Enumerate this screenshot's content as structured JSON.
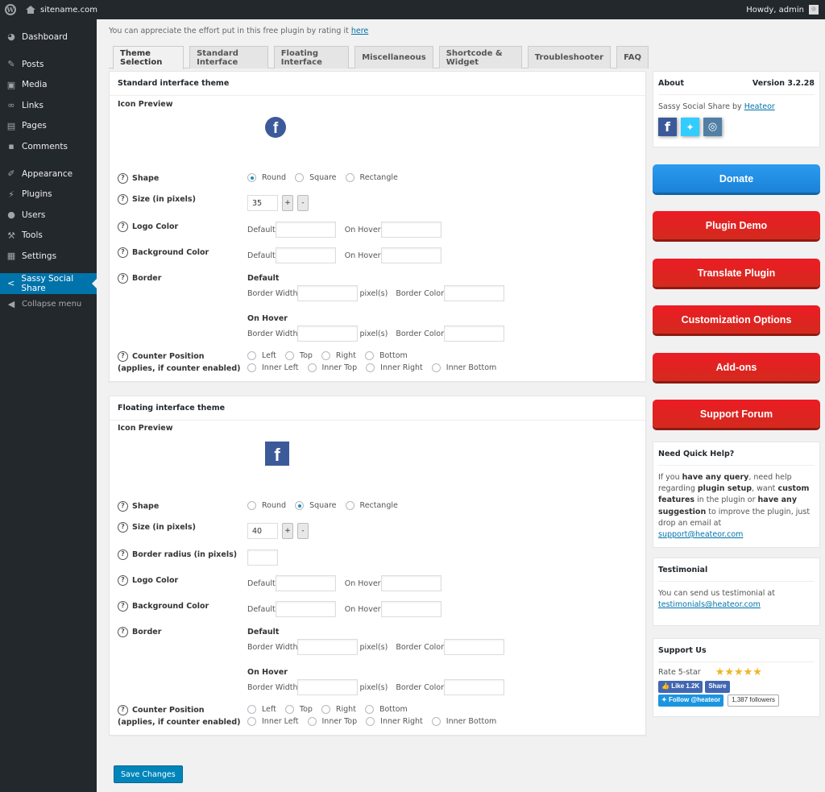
{
  "adminbar": {
    "site_name": "sitename.com",
    "howdy": "Howdy, admin"
  },
  "sidebar": {
    "items": [
      {
        "label": "Dashboard",
        "icon": "dashboard-icon"
      },
      {
        "label": "Posts",
        "icon": "pin-icon"
      },
      {
        "label": "Media",
        "icon": "media-icon"
      },
      {
        "label": "Links",
        "icon": "link-icon"
      },
      {
        "label": "Pages",
        "icon": "pages-icon"
      },
      {
        "label": "Comments",
        "icon": "comment-icon"
      },
      {
        "label": "Appearance",
        "icon": "brush-icon"
      },
      {
        "label": "Plugins",
        "icon": "plugin-icon"
      },
      {
        "label": "Users",
        "icon": "user-icon"
      },
      {
        "label": "Tools",
        "icon": "wrench-icon"
      },
      {
        "label": "Settings",
        "icon": "settings-icon"
      },
      {
        "label": "Sassy Social Share",
        "icon": "share-icon",
        "active": true
      },
      {
        "label": "Collapse menu",
        "icon": "collapse-icon"
      }
    ]
  },
  "notice": {
    "text": "You can appreciate the effort put in this free plugin by rating it ",
    "link": "here"
  },
  "tabs": [
    "Theme Selection",
    "Standard Interface",
    "Floating Interface",
    "Miscellaneous",
    "Shortcode & Widget",
    "Troubleshooter",
    "FAQ"
  ],
  "labels": {
    "icon_preview": "Icon Preview",
    "shape": "Shape",
    "size": "Size (in pixels)",
    "border_radius": "Border radius (in pixels)",
    "logo_color": "Logo Color",
    "background_color": "Background Color",
    "border": "Border",
    "counter_position": "Counter Position",
    "counter_note": "(applies, if counter enabled)",
    "default": "Default",
    "on_hover": "On Hover",
    "border_width": "Border Width",
    "pixels": "pixel(s)",
    "border_color": "Border Color",
    "plus": "+",
    "minus": "-",
    "fb_glyph": "f"
  },
  "shape_options": [
    "Round",
    "Square",
    "Rectangle"
  ],
  "counter_options_row1": [
    "Left",
    "Top",
    "Right",
    "Bottom"
  ],
  "counter_options_row2": [
    "Inner Left",
    "Inner Top",
    "Inner Right",
    "Inner Bottom"
  ],
  "standard": {
    "title": "Standard interface theme",
    "shape_selected": "Round",
    "size": "35",
    "logo_default": "",
    "logo_hover": "",
    "bg_default": "",
    "bg_hover": "",
    "border_width": "",
    "border_color": "",
    "hover_border_width": "",
    "hover_border_color": ""
  },
  "floating": {
    "title": "Floating interface theme",
    "shape_selected": "Square",
    "size": "40",
    "border_radius": "",
    "logo_default": "",
    "logo_hover": "",
    "bg_default": "",
    "bg_hover": "",
    "border_width": "",
    "border_color": "",
    "hover_border_width": "",
    "hover_border_color": ""
  },
  "about": {
    "title": "About",
    "version": "Version 3.2.28",
    "by_text": "Sassy Social Share by ",
    "author": "Heateor"
  },
  "buttons": {
    "donate": "Donate",
    "plugin_demo": "Plugin Demo",
    "translate": "Translate Plugin",
    "customization": "Customization Options",
    "addons": "Add-ons",
    "support_forum": "Support Forum"
  },
  "help": {
    "title": "Need Quick Help?",
    "p1": "If you ",
    "b1": "have any query",
    "p2": ", need help regarding ",
    "b2": "plugin setup",
    "p3": ", want ",
    "b3": "custom features",
    "p4": " in the plugin or ",
    "b4": "have any suggestion",
    "p5": " to improve the plugin, just drop an email at ",
    "email": "support@heateor.com"
  },
  "testimonial": {
    "title": "Testimonial",
    "text": "You can send us testimonial at ",
    "email": "testimonials@heateor.com"
  },
  "support_us": {
    "title": "Support Us",
    "rate": "Rate 5-star",
    "rating": 5,
    "stars": "★★★★★",
    "like": "Like 1.2K",
    "share": "Share",
    "follow": "Follow @heateor",
    "followers": "1,387 followers"
  },
  "save_label": "Save Changes",
  "colors": {
    "accent": "#0073aa",
    "facebook": "#3c5a99",
    "donate": "#1a82d8",
    "red": "#e31e24"
  }
}
